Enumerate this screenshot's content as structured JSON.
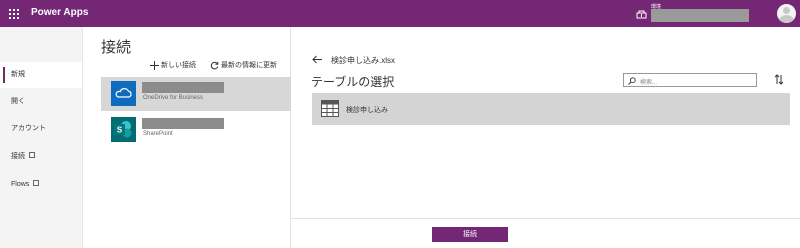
{
  "topbar": {
    "app_title": "Power Apps",
    "env_label": "環境",
    "env_name_redacted": "",
    "brand_color": "#742774"
  },
  "nav": {
    "items": [
      {
        "label": "新規",
        "active": true
      },
      {
        "label": "開く"
      },
      {
        "label": "アカウント"
      },
      {
        "label": "接続"
      },
      {
        "label": "Flows"
      }
    ]
  },
  "connections": {
    "title": "接続",
    "new_connection": "新しい接続",
    "refresh": "最新の情報に更新",
    "items": [
      {
        "name_redacted": "",
        "service": "OneDrive for Business",
        "icon": "onedrive-cloud-icon",
        "color": "#0f6cbd",
        "selected": true
      },
      {
        "name_redacted": "",
        "service": "SharePoint",
        "icon": "sharepoint-icon",
        "color": "#036c70"
      }
    ]
  },
  "main": {
    "file_name": "検診申し込み.xlsx",
    "section_title": "テーブルの選択",
    "search_placeholder": "検索...",
    "tables": [
      {
        "name": "検診申し込み",
        "icon": "table-grid-icon"
      }
    ],
    "connect_button": "接続"
  }
}
